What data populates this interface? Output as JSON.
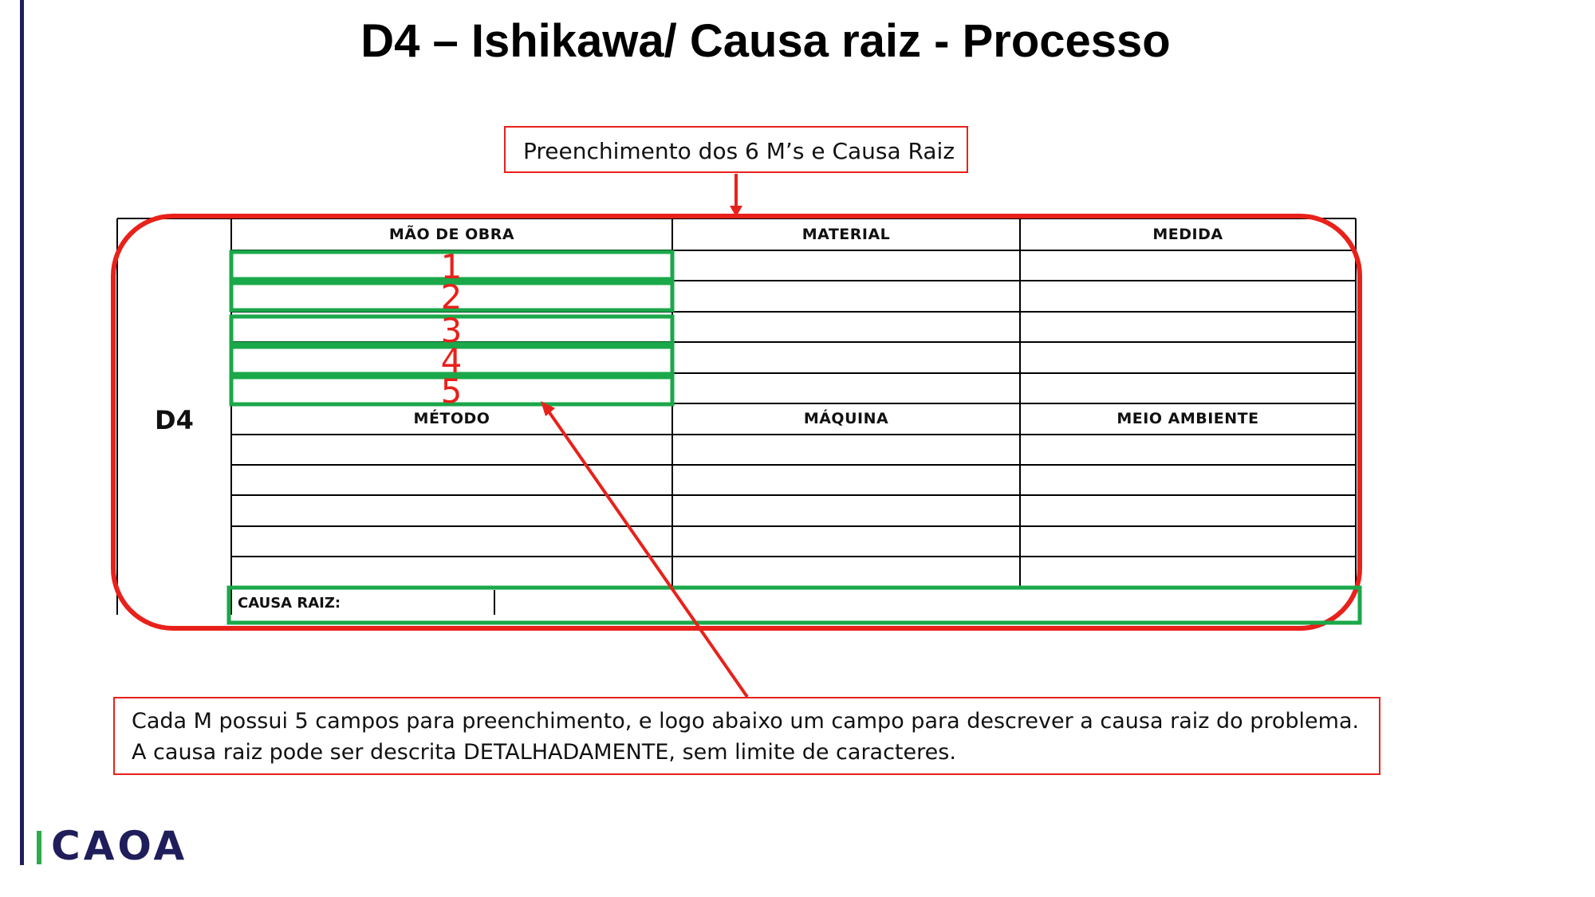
{
  "title": "D4 – Ishikawa/ Causa raiz - Processo",
  "callout_top": "Preenchimento dos 6 M’s e Causa Raiz",
  "callout_bottom": {
    "line1": "Cada M possui 5 campos para preenchimento, e logo abaixo um campo para descrever a causa raiz do problema.",
    "line2": "A causa raiz pode ser descrita DETALHADAMENTE, sem limite de caracteres."
  },
  "form": {
    "section_label": "D4",
    "headers_top": [
      "MÃO DE OBRA",
      "MATERIAL",
      "MEDIDA"
    ],
    "headers_bottom": [
      "MÉTODO",
      "MÁQUINA",
      "MEIO AMBIENTE"
    ],
    "causa_raiz_label": "CAUSA RAIZ:",
    "field_numbers": [
      "1",
      "2",
      "3",
      "4",
      "5"
    ]
  },
  "logo": {
    "text": "CAOA",
    "bar_color": "#2eaa4a",
    "text_color": "#1f1d5a"
  },
  "colors": {
    "highlight_red": "#e8211a",
    "highlight_green": "#1aa84a",
    "rule": "#1f1d5a"
  }
}
